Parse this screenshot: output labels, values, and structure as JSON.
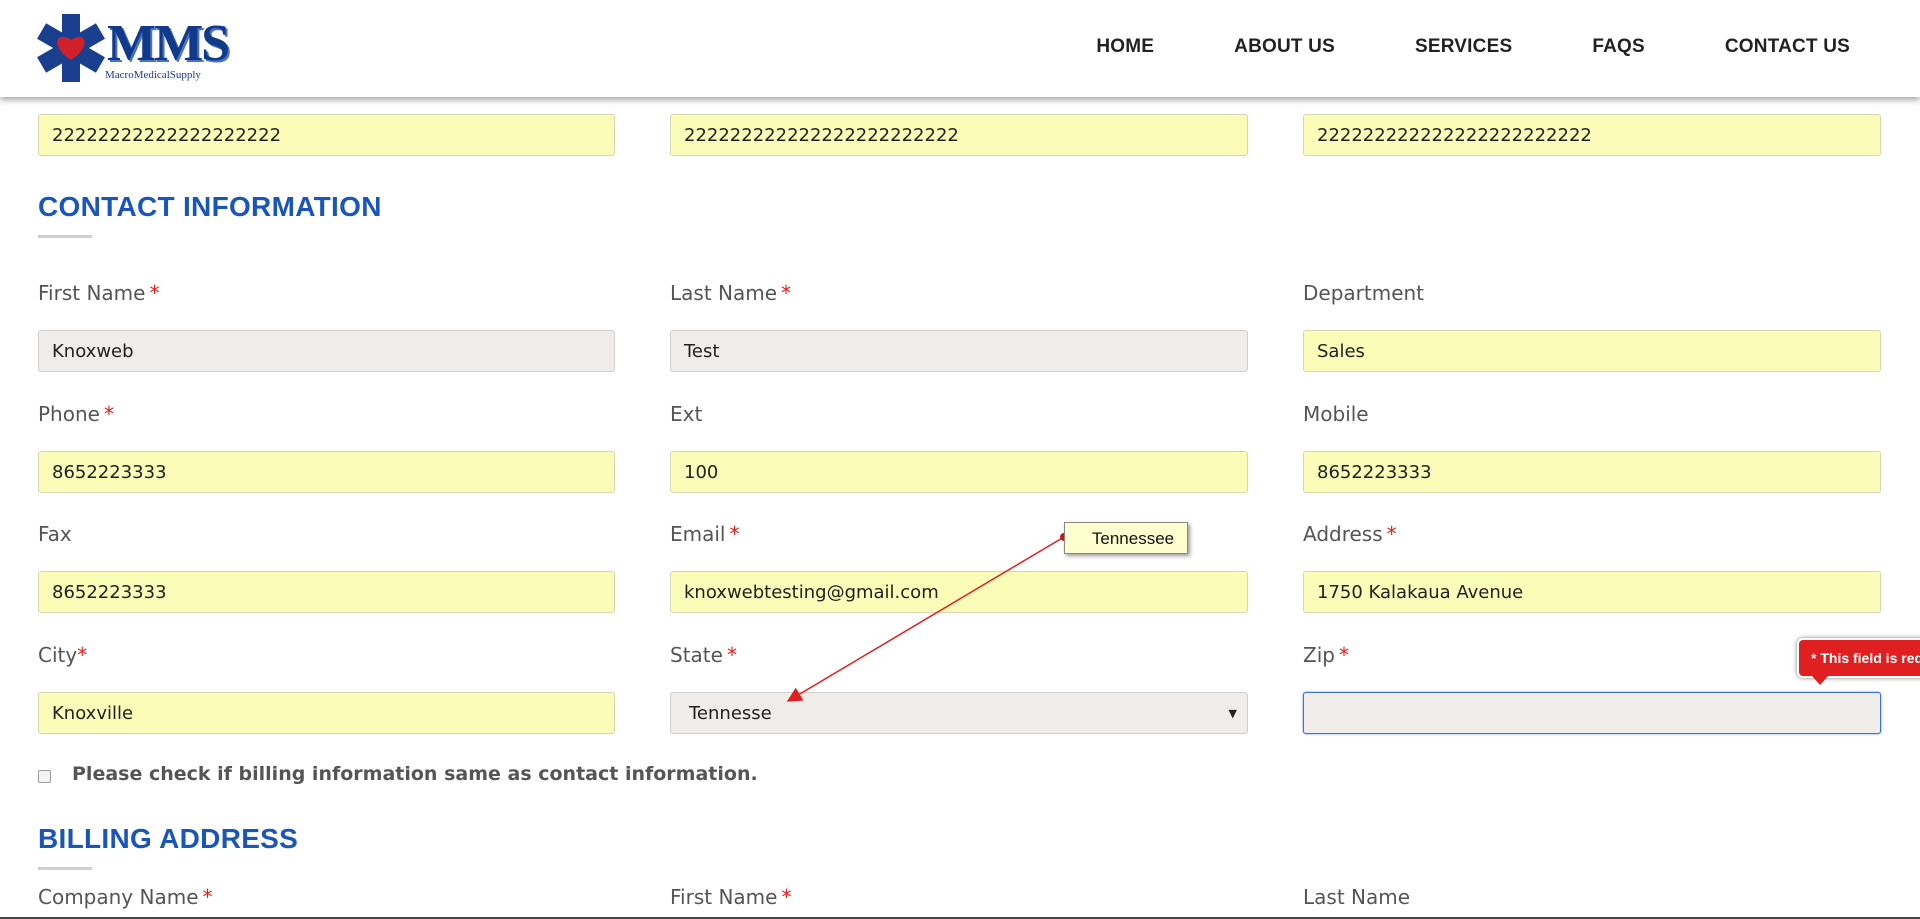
{
  "header": {
    "logo_text": "MMS",
    "logo_sub": "MacroMedicalSupply",
    "nav": [
      "HOME",
      "ABOUT US",
      "SERVICES",
      "FAQS",
      "CONTACT US"
    ]
  },
  "top_row": {
    "values": [
      "22222222222222222222",
      "222222222222222222222222",
      "222222222222222222222222"
    ]
  },
  "contact": {
    "title": "CONTACT INFORMATION",
    "fields": {
      "first_name": {
        "label": "First Name",
        "value": "Knoxweb"
      },
      "last_name": {
        "label": "Last Name",
        "value": "Test"
      },
      "department": {
        "label": "Department",
        "value": "Sales"
      },
      "phone": {
        "label": "Phone",
        "value": "8652223333"
      },
      "ext": {
        "label": "Ext",
        "value": "100"
      },
      "mobile": {
        "label": "Mobile",
        "value": "8652223333"
      },
      "fax": {
        "label": "Fax",
        "value": "8652223333"
      },
      "email": {
        "label": "Email",
        "value": "knoxwebtesting@gmail.com"
      },
      "address": {
        "label": "Address",
        "value": "1750 Kalakaua Avenue"
      },
      "city": {
        "label": "City",
        "value": "Knoxville"
      },
      "state": {
        "label": "State",
        "value": "Tennesse"
      },
      "zip": {
        "label": "Zip",
        "value": ""
      }
    },
    "required_mark": "*",
    "billing_same_label": "Please check if billing information same as contact information."
  },
  "annotation": {
    "tooltip_text": "Tennessee",
    "error_text": "* This field is required"
  },
  "billing": {
    "title": "BILLING ADDRESS",
    "labels": {
      "company_name": "Company Name",
      "first_name": "First Name",
      "last_name": "Last Name"
    }
  },
  "colors": {
    "accent": "#1a56b8",
    "field_fill": "#fafcb8",
    "readonly_fill": "#efecea",
    "required": "#e02020"
  }
}
